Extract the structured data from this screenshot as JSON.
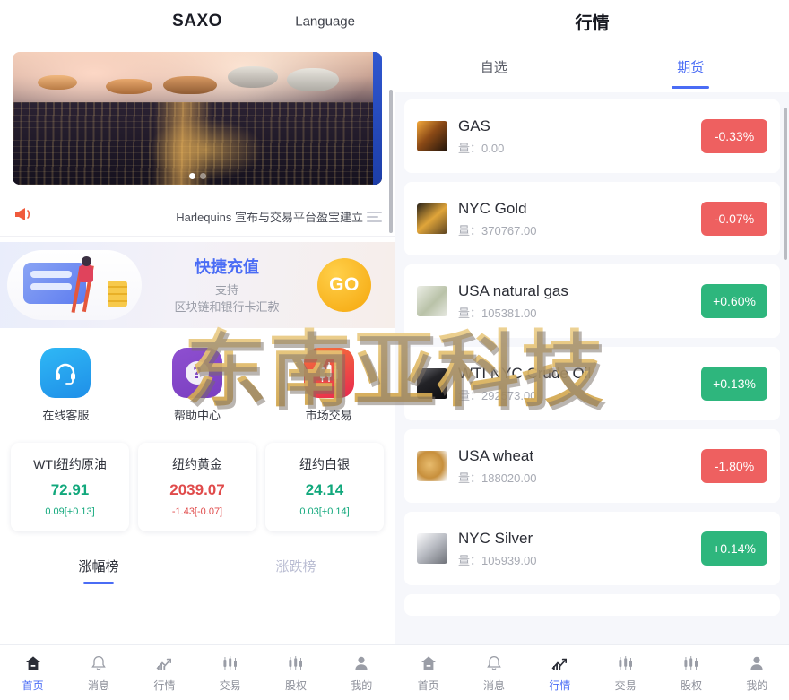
{
  "left": {
    "header": {
      "logo": "SAXO",
      "language": "Language"
    },
    "hero": {
      "dots": 2,
      "active_dot": 0,
      "alt": "city-night-coins-banner"
    },
    "notice": {
      "icon": "megaphone-icon",
      "text": "Harlequins 宣布与交易平台盈宝建立",
      "more_icon": "list-icon"
    },
    "recharge": {
      "title": "快捷充值",
      "subtitle_line1": "支持",
      "subtitle_line2": "区块链和银行卡汇款",
      "go_label": "GO"
    },
    "quick_actions": [
      {
        "label": "在线客服",
        "icon": "headset-icon",
        "color": "#2fb8f5"
      },
      {
        "label": "帮助中心",
        "icon": "question-icon",
        "color": "#8e4fd0"
      },
      {
        "label": "市场交易",
        "icon": "candlestick-icon",
        "color": "#e8294f"
      }
    ],
    "price_cards": [
      {
        "name": "WTI纽约原油",
        "price": "72.91",
        "change": "0.09[+0.13]",
        "dir": "up"
      },
      {
        "name": "纽约黄金",
        "price": "2039.07",
        "change": "-1.43[-0.07]",
        "dir": "down"
      },
      {
        "name": "纽约白银",
        "price": "24.14",
        "change": "0.03[+0.14]",
        "dir": "up"
      }
    ],
    "rank_tabs": [
      {
        "label": "涨幅榜",
        "active": true
      },
      {
        "label": "涨跌榜",
        "active": false
      }
    ]
  },
  "right": {
    "header": {
      "title": "行情"
    },
    "tabs": [
      {
        "label": "自选",
        "active": false
      },
      {
        "label": "期货",
        "active": true
      }
    ],
    "vol_prefix": "量：",
    "items": [
      {
        "name": "GAS",
        "volume": "量：0.00",
        "change": "-0.33%",
        "dir": "neg",
        "thumb": "th-gas",
        "icon": "gas-thumbnail"
      },
      {
        "name": "NYC Gold",
        "volume": "量：370767.00",
        "change": "-0.07%",
        "dir": "neg",
        "thumb": "th-gold",
        "icon": "gold-thumbnail"
      },
      {
        "name": "USA natural gas",
        "volume": "量：105381.00",
        "change": "+0.60%",
        "dir": "pos",
        "thumb": "th-natgas",
        "icon": "natural-gas-thumbnail"
      },
      {
        "name": "WTI NYC Crude Oil",
        "volume": "量：292573.00",
        "change": "+0.13%",
        "dir": "pos",
        "thumb": "th-oil",
        "icon": "crude-oil-thumbnail"
      },
      {
        "name": "USA wheat",
        "volume": "量：188020.00",
        "change": "-1.80%",
        "dir": "neg",
        "thumb": "th-wheat",
        "icon": "wheat-thumbnail"
      },
      {
        "name": "NYC Silver",
        "volume": "量：105939.00",
        "change": "+0.14%",
        "dir": "pos",
        "thumb": "th-silver",
        "icon": "silver-thumbnail"
      }
    ]
  },
  "tabbar_left": [
    {
      "label": "首页",
      "icon": "home-icon",
      "active": true
    },
    {
      "label": "消息",
      "icon": "bell-icon",
      "active": false
    },
    {
      "label": "行情",
      "icon": "chart-up-icon",
      "active": false
    },
    {
      "label": "交易",
      "icon": "candlestick-icon",
      "active": false
    },
    {
      "label": "股权",
      "icon": "candlestick-icon",
      "active": false
    },
    {
      "label": "我的",
      "icon": "user-icon",
      "active": false
    }
  ],
  "tabbar_right": [
    {
      "label": "首页",
      "icon": "home-icon",
      "active": false
    },
    {
      "label": "消息",
      "icon": "bell-icon",
      "active": false
    },
    {
      "label": "行情",
      "icon": "chart-up-icon",
      "active": true
    },
    {
      "label": "交易",
      "icon": "candlestick-icon",
      "active": false
    },
    {
      "label": "股权",
      "icon": "candlestick-icon",
      "active": false
    },
    {
      "label": "我的",
      "icon": "user-icon",
      "active": false
    }
  ],
  "watermark": {
    "text": "东南亚科技"
  },
  "colors": {
    "accent": "#4a6cf5",
    "up": "#12a87c",
    "down": "#e04b4b",
    "badge_neg": "#ee6060",
    "badge_pos": "#2eb67d"
  }
}
